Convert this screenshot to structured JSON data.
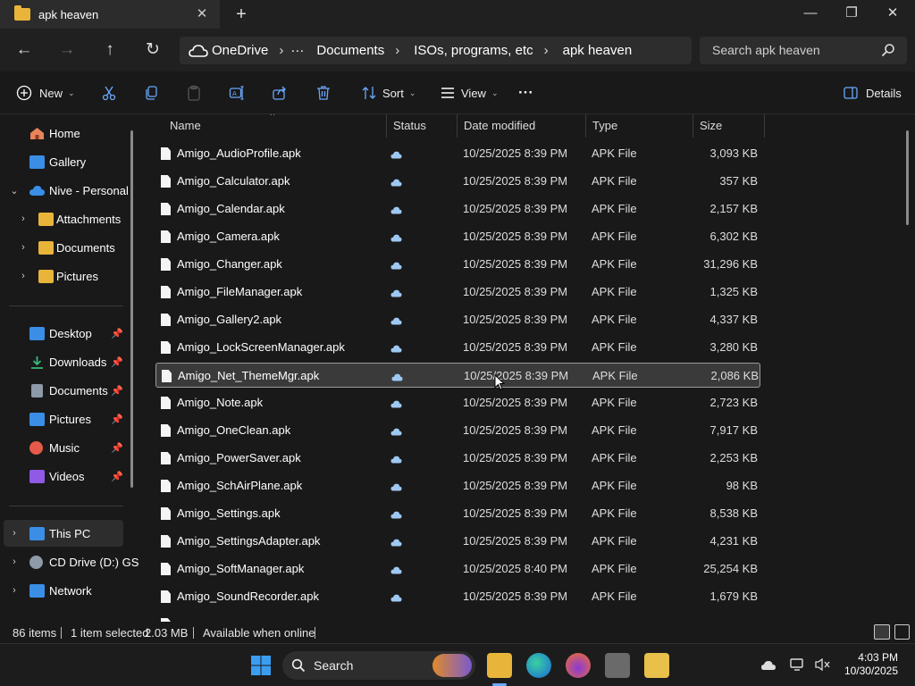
{
  "window": {
    "tab_title": "apk heaven",
    "close_tab": "✕",
    "new_tab": "+",
    "minimize": "—",
    "maximize": "❐",
    "close": "✕"
  },
  "nav": {
    "back": "←",
    "forward": "→",
    "up": "↑",
    "refresh": "↻"
  },
  "breadcrumb": {
    "root": "OneDrive",
    "more": "···",
    "items": [
      "Documents",
      "ISOs, programs, etc",
      "apk heaven"
    ],
    "sep": "›"
  },
  "search": {
    "placeholder": "Search apk heaven"
  },
  "toolbar": {
    "new_label": "New",
    "sort_label": "Sort",
    "view_label": "View",
    "more": "···",
    "details_label": "Details"
  },
  "sidebar": {
    "quick": [
      {
        "label": "Home",
        "icon": "home-icon",
        "color": "#e8845a"
      },
      {
        "label": "Gallery",
        "icon": "gallery-icon",
        "color": "#3a8ee6"
      },
      {
        "label": "Nive - Personal",
        "icon": "onedrive-icon",
        "color": "#3a8ee6"
      },
      {
        "label": "Attachments",
        "icon": "folder-icon",
        "color": "#e8b53a"
      },
      {
        "label": "Documents",
        "icon": "folder-icon",
        "color": "#e8b53a"
      },
      {
        "label": "Pictures",
        "icon": "folder-icon",
        "color": "#e8b53a"
      }
    ],
    "pinned": [
      {
        "label": "Desktop",
        "icon": "desktop-icon",
        "color": "#3a8ee6"
      },
      {
        "label": "Downloads",
        "icon": "download-icon",
        "color": "#3ab87a"
      },
      {
        "label": "Documents",
        "icon": "document-icon",
        "color": "#8e9aa8"
      },
      {
        "label": "Pictures",
        "icon": "pictures-icon",
        "color": "#3a8ee6"
      },
      {
        "label": "Music",
        "icon": "music-icon",
        "color": "#e65a4a"
      },
      {
        "label": "Videos",
        "icon": "videos-icon",
        "color": "#8e5ae6"
      }
    ],
    "devices": [
      {
        "label": "This PC",
        "icon": "pc-icon",
        "color": "#3a8ee6"
      },
      {
        "label": "CD Drive (D:) GS",
        "icon": "cd-drive-icon",
        "color": "#8e9aa8"
      },
      {
        "label": "Network",
        "icon": "network-icon",
        "color": "#3a8ee6"
      }
    ]
  },
  "columns": {
    "name": "Name",
    "status": "Status",
    "date": "Date modified",
    "type": "Type",
    "size": "Size"
  },
  "files": [
    {
      "name": "Amigo_AudioProfile.apk",
      "date": "10/25/2025 8:39 PM",
      "type": "APK File",
      "size": "3,093 KB"
    },
    {
      "name": "Amigo_Calculator.apk",
      "date": "10/25/2025 8:39 PM",
      "type": "APK File",
      "size": "357 KB"
    },
    {
      "name": "Amigo_Calendar.apk",
      "date": "10/25/2025 8:39 PM",
      "type": "APK File",
      "size": "2,157 KB"
    },
    {
      "name": "Amigo_Camera.apk",
      "date": "10/25/2025 8:39 PM",
      "type": "APK File",
      "size": "6,302 KB"
    },
    {
      "name": "Amigo_Changer.apk",
      "date": "10/25/2025 8:39 PM",
      "type": "APK File",
      "size": "31,296 KB"
    },
    {
      "name": "Amigo_FileManager.apk",
      "date": "10/25/2025 8:39 PM",
      "type": "APK File",
      "size": "1,325 KB"
    },
    {
      "name": "Amigo_Gallery2.apk",
      "date": "10/25/2025 8:39 PM",
      "type": "APK File",
      "size": "4,337 KB"
    },
    {
      "name": "Amigo_LockScreenManager.apk",
      "date": "10/25/2025 8:39 PM",
      "type": "APK File",
      "size": "3,280 KB"
    },
    {
      "name": "Amigo_Net_ThemeMgr.apk",
      "date": "10/25/2025 8:39 PM",
      "type": "APK File",
      "size": "2,086 KB",
      "selected": true
    },
    {
      "name": "Amigo_Note.apk",
      "date": "10/25/2025 8:39 PM",
      "type": "APK File",
      "size": "2,723 KB"
    },
    {
      "name": "Amigo_OneClean.apk",
      "date": "10/25/2025 8:39 PM",
      "type": "APK File",
      "size": "7,917 KB"
    },
    {
      "name": "Amigo_PowerSaver.apk",
      "date": "10/25/2025 8:39 PM",
      "type": "APK File",
      "size": "2,253 KB"
    },
    {
      "name": "Amigo_SchAirPlane.apk",
      "date": "10/25/2025 8:39 PM",
      "type": "APK File",
      "size": "98 KB"
    },
    {
      "name": "Amigo_Settings.apk",
      "date": "10/25/2025 8:39 PM",
      "type": "APK File",
      "size": "8,538 KB"
    },
    {
      "name": "Amigo_SettingsAdapter.apk",
      "date": "10/25/2025 8:39 PM",
      "type": "APK File",
      "size": "4,231 KB"
    },
    {
      "name": "Amigo_SoftManager.apk",
      "date": "10/25/2025 8:40 PM",
      "type": "APK File",
      "size": "25,254 KB"
    },
    {
      "name": "Amigo_SoundRecorder.apk",
      "date": "10/25/2025 8:39 PM",
      "type": "APK File",
      "size": "1,679 KB"
    }
  ],
  "status": {
    "items": "86 items",
    "selected": "1 item selected",
    "size": "2.03 MB",
    "availability": "Available when online"
  },
  "taskbar": {
    "search_label": "Search",
    "time": "4:03 PM",
    "date": "10/30/2025"
  }
}
